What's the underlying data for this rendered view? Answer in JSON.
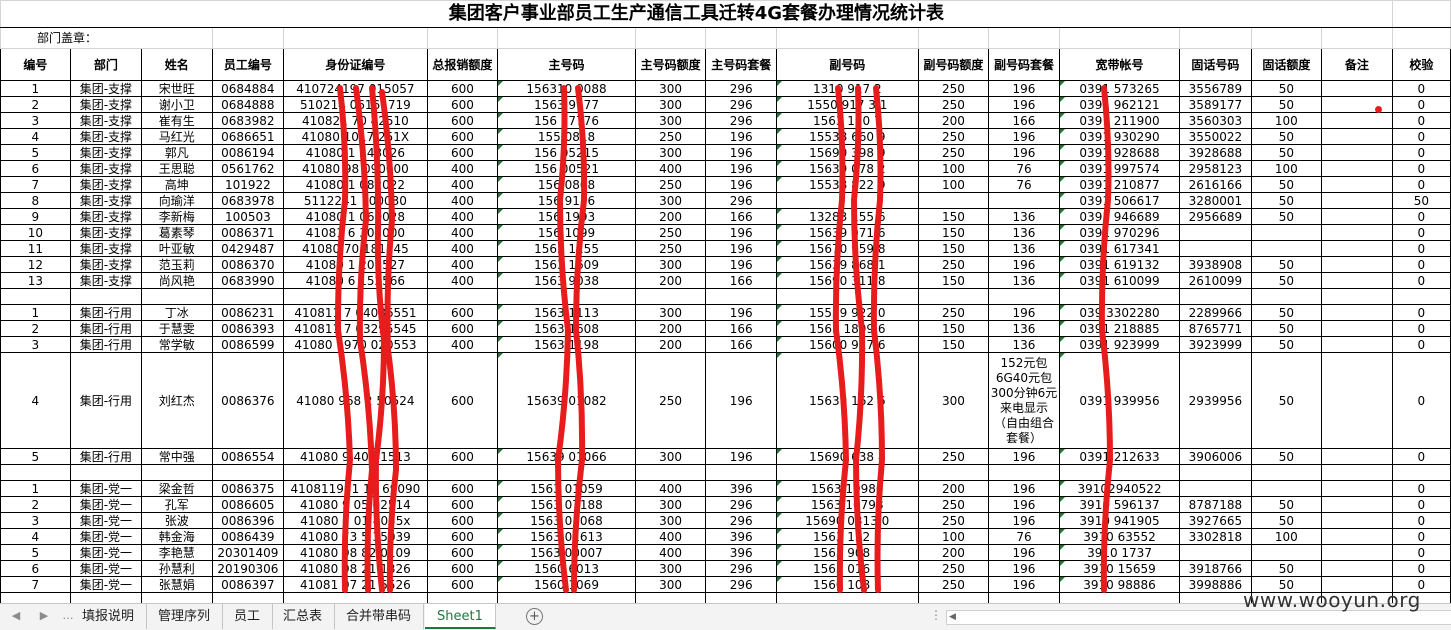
{
  "title": "集团客户事业部员工生产通信工具迁转4G套餐办理情况统计表",
  "stamp_label": "部门盖章：",
  "headers": [
    "编号",
    "部门",
    "姓名",
    "员工编号",
    "身份证编号",
    "总报销额度",
    "主号码",
    "主号码额度",
    "主号码套餐",
    "副号码",
    "副号码额度",
    "副号码套餐",
    "宽带帐号",
    "固话号码",
    "固话额度",
    "备注",
    "校验"
  ],
  "groups": [
    {
      "rows": [
        [
          "1",
          "集团-支撑",
          "宋世旺",
          "0684884",
          "410724197   015057",
          "600",
          "156310  0088",
          "300",
          "296",
          "1310  917  2",
          "250",
          "196",
          "0391  573265",
          "3556789",
          "50",
          "",
          "0"
        ],
        [
          "2",
          "集团-支撑",
          "谢小卫",
          "0684888",
          "510214   06161719",
          "600",
          "1563  9177",
          "300",
          "296",
          "1550  917 3 1",
          "250",
          "196",
          "0391  962121",
          "3589177",
          "50",
          "",
          "0"
        ],
        [
          "3",
          "集团-支撑",
          "崔有生",
          "0683982",
          "410821  70  42510",
          "600",
          "156  17776",
          "300",
          "296",
          "1563  120  7",
          "200",
          "166",
          "0391  211900",
          "3560303",
          "100",
          "",
          "0"
        ],
        [
          "4",
          "集团-支撑",
          "马红光",
          "0686651",
          "41080   1017  251X",
          "600",
          "155  0818",
          "250",
          "196",
          "15538  660  9",
          "250",
          "196",
          "0391  930290",
          "3550022",
          "50",
          "",
          "0"
        ],
        [
          "5",
          "集团-支撑",
          "郭凡",
          "0086194",
          "41080   1  243026",
          "600",
          "156  05215",
          "300",
          "196",
          "15690  398  9",
          "250",
          "196",
          "0391  928688",
          "3928688",
          "50",
          "",
          "0"
        ],
        [
          "6",
          "集团-支撑",
          "王思聪",
          "0561762",
          "41080   98  090000",
          "400",
          "156  00521",
          "400",
          "196",
          "15639  078  2",
          "100",
          "76",
          "0391  997574",
          "2958123",
          "100",
          "",
          "0"
        ],
        [
          "7",
          "集团-支撑",
          "高坤",
          "101922",
          "41080   1  082022",
          "400",
          "156  0808",
          "250",
          "196",
          "15538  822  9",
          "100",
          "76",
          "0391  210877",
          "2616166",
          "50",
          "",
          "0"
        ],
        [
          "8",
          "集团-支撑",
          "向瑜洋",
          "0683978",
          "5112241   100030",
          "400",
          "156  9116",
          "300",
          "296",
          "",
          "",
          "",
          "0391  506617",
          "3280001",
          "50",
          "",
          "50"
        ],
        [
          "9",
          "集团-支撑",
          "李新梅",
          "100503",
          "41080   1  060028",
          "400",
          "156  1993",
          "200",
          "166",
          "13283  155  6",
          "150",
          "136",
          "0391  946689",
          "2956689",
          "50",
          "",
          "0"
        ],
        [
          "10",
          "集团-支撑",
          "葛素琴",
          "0086371",
          "41081  6  305000",
          "400",
          "156  1099",
          "250",
          "196",
          "15639  071  6",
          "150",
          "136",
          "0391  970296",
          "",
          "",
          "",
          "0"
        ],
        [
          "11",
          "集团-支撑",
          "叶亚敏",
          "0429487",
          "41080   70  181545",
          "400",
          "1563  1155",
          "250",
          "196",
          "15670  959  8",
          "150",
          "136",
          "0391  617341",
          "",
          "",
          "",
          "0"
        ],
        [
          "12",
          "集团-支撑",
          "范玉莉",
          "0086370",
          "41080   1  203527",
          "400",
          "1563  1609",
          "300",
          "196",
          "15639  868  1",
          "250",
          "196",
          "0391  619132",
          "3938908",
          "50",
          "",
          "0"
        ],
        [
          "13",
          "集团-支撑",
          "尚风艳",
          "0683990",
          "41080   6  152566",
          "400",
          "1563  9038",
          "200",
          "166",
          "15690  311  8",
          "150",
          "136",
          "0391  610099",
          "2610099",
          "50",
          "",
          "0"
        ]
      ]
    },
    {
      "rows": [
        [
          "1",
          "集团-行用",
          "丁冰",
          "0086231",
          "410811   7  04086551",
          "600",
          "1563  1113",
          "300",
          "196",
          "15539  922  0",
          "250",
          "196",
          "039  3302280",
          "2289966",
          "50",
          "",
          "0"
        ],
        [
          "2",
          "集团-行用",
          "于慧雯",
          "0086393",
          "410811   7  03295545",
          "600",
          "1563  1608",
          "200",
          "166",
          "1563  1899  6",
          "150",
          "136",
          "0391  218885",
          "8765771",
          "50",
          "",
          "0"
        ],
        [
          "3",
          "集团-行用",
          "常学敏",
          "0086599",
          "41080   1970  020553",
          "400",
          "1563  1198",
          "200",
          "166",
          "15600  917  6",
          "150",
          "136",
          "0391  923999",
          "3923999",
          "50",
          "",
          "0"
        ],
        [
          "4",
          "集团-行用",
          "刘红杰",
          "0086376",
          "41080   968  2  50524",
          "600",
          "15639  01082",
          "250",
          "196",
          "15639  162  6",
          "300",
          "152元包6G40元包300分钟6元来电显示（自由组合套餐）",
          "0391  939956",
          "2939956",
          "50",
          "",
          "0"
        ],
        [
          "5",
          "集团-行用",
          "常中强",
          "0086554",
          "41080   9  40  61513",
          "600",
          "15639  01066",
          "300",
          "196",
          "15690  638  8",
          "250",
          "196",
          "0391  212633",
          "3906006",
          "50",
          "",
          "0"
        ]
      ]
    },
    {
      "rows": [
        [
          "1",
          "集团-党一",
          "梁金哲",
          "0086375",
          "410811981   10  69090",
          "600",
          "1563  01059",
          "400",
          "396",
          "1563  10980",
          "200",
          "196",
          "39102940522",
          "",
          "",
          "",
          "0"
        ],
        [
          "2",
          "集团-党一",
          "孔军",
          "0086605",
          "41080   9  05  02514",
          "600",
          "1563  07188",
          "300",
          "296",
          "1563  10798",
          "250",
          "196",
          "3910  596137",
          "8787188",
          "50",
          "",
          "0"
        ],
        [
          "3",
          "集团-党一",
          "张波",
          "0086396",
          "41080   7  01  4055x",
          "600",
          "1563  01068",
          "300",
          "296",
          "15690  0313  0",
          "250",
          "196",
          "3910  941905",
          "3927665",
          "50",
          "",
          "0"
        ],
        [
          "4",
          "集团-党一",
          "韩金海",
          "0086439",
          "41080   73  5  35039",
          "600",
          "1563  01613",
          "400",
          "396",
          "1563  152  3",
          "100",
          "76",
          "3910  63552",
          "3302818",
          "100",
          "",
          "0"
        ],
        [
          "5",
          "集团-党一",
          "李艳慧",
          "20301409",
          "41080   98  82  0109",
          "600",
          "1563  00007",
          "400",
          "396",
          "1563  908  2",
          "200",
          "196",
          "3910  1737",
          "",
          "",
          "",
          "0"
        ],
        [
          "6",
          "集团-党一",
          "孙慧利",
          "20190306",
          "41080   98  21  1326",
          "600",
          "1560  6013",
          "300",
          "296",
          "1563  016  1",
          "250",
          "196",
          "3910  15659",
          "3918766",
          "50",
          "",
          "0"
        ],
        [
          "7",
          "集团-党一",
          "张慧娟",
          "0086397",
          "41081   97  21  5526",
          "600",
          "1560  1069",
          "300",
          "296",
          "1560  108  3",
          "250",
          "196",
          "3910  98886",
          "3998886",
          "50",
          "",
          "0"
        ]
      ]
    }
  ],
  "tabs": [
    "填报说明",
    "管理序列",
    "员工",
    "汇总表",
    "合并带串码",
    "Sheet1"
  ],
  "active_tab": "Sheet1",
  "watermark": "www.wooyun.org",
  "colors": {
    "red_marks": "#e81c1c",
    "active_tab": "#1e7a3c",
    "grid": "#000000"
  }
}
